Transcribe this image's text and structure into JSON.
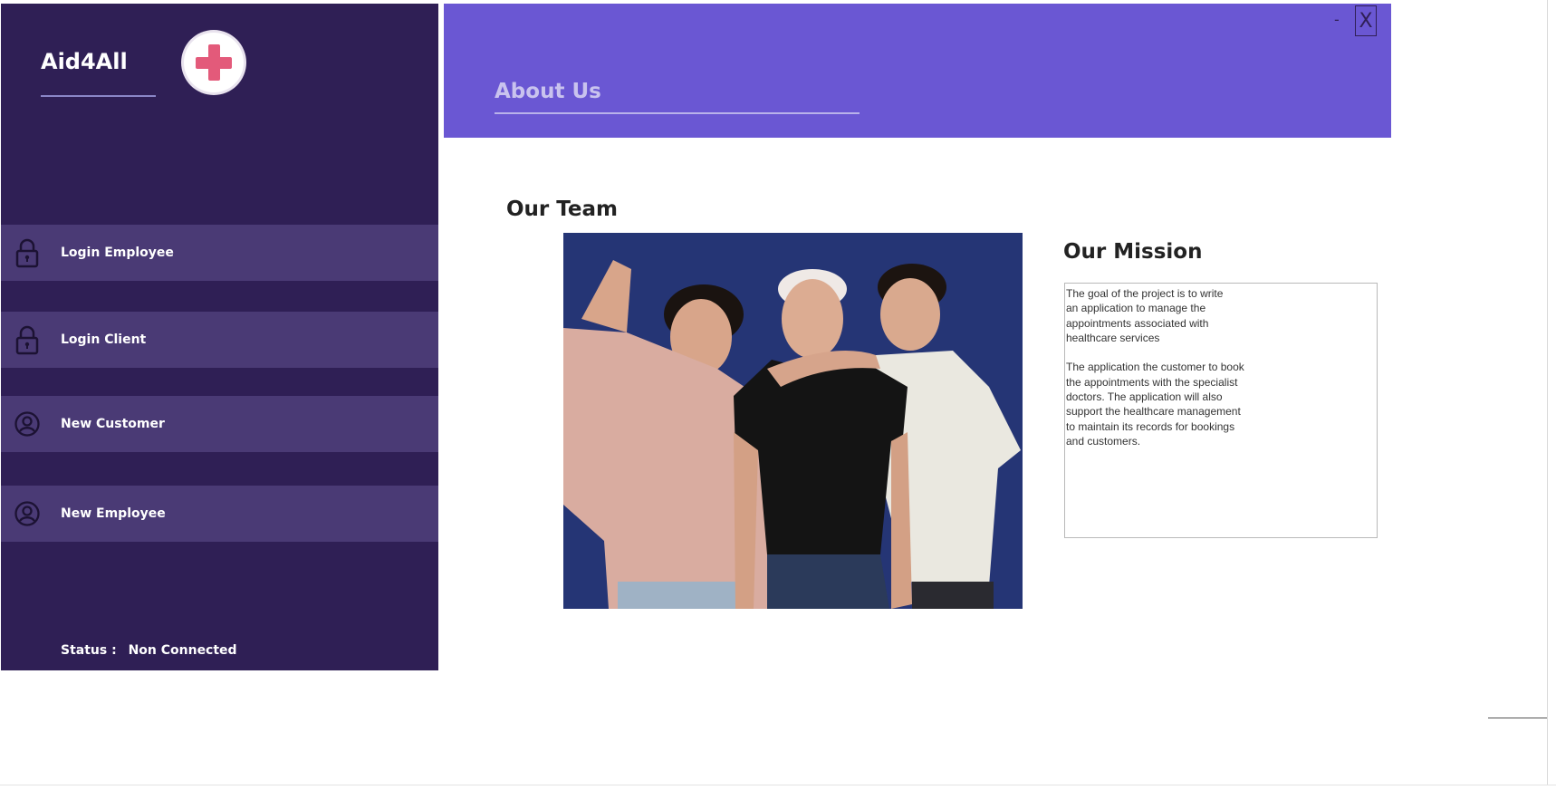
{
  "app": {
    "brand_name": "Aid4All",
    "logo_icon": "red-cross-icon"
  },
  "sidebar": {
    "items": [
      {
        "label": "Login Employee",
        "icon": "lock-icon"
      },
      {
        "label": "Login Client",
        "icon": "lock-icon"
      },
      {
        "label": "New Customer",
        "icon": "user-circle-icon"
      },
      {
        "label": "New Employee",
        "icon": "user-circle-icon"
      }
    ],
    "status_label": "Status :",
    "status_value": "Non Connected"
  },
  "header": {
    "title": "About Us",
    "minimize_label": "-",
    "close_label": "X"
  },
  "main": {
    "team_heading": "Our Team",
    "mission_heading": "Our Mission",
    "mission_text": "The goal of the project is to write\nan application to manage the\nappointments associated with\nhealthcare services\n\nThe application the customer to book\nthe appointments with the specialist\ndoctors. The application will also\nsupport the healthcare management\nto maintain its records for bookings\nand customers."
  },
  "colors": {
    "sidebar_bg": "#2f1f55",
    "nav_item_bg": "#4a3a75",
    "header_bg": "#6a57d3",
    "title_color": "#c9c3ee",
    "logo_cross": "#e35a7a"
  }
}
